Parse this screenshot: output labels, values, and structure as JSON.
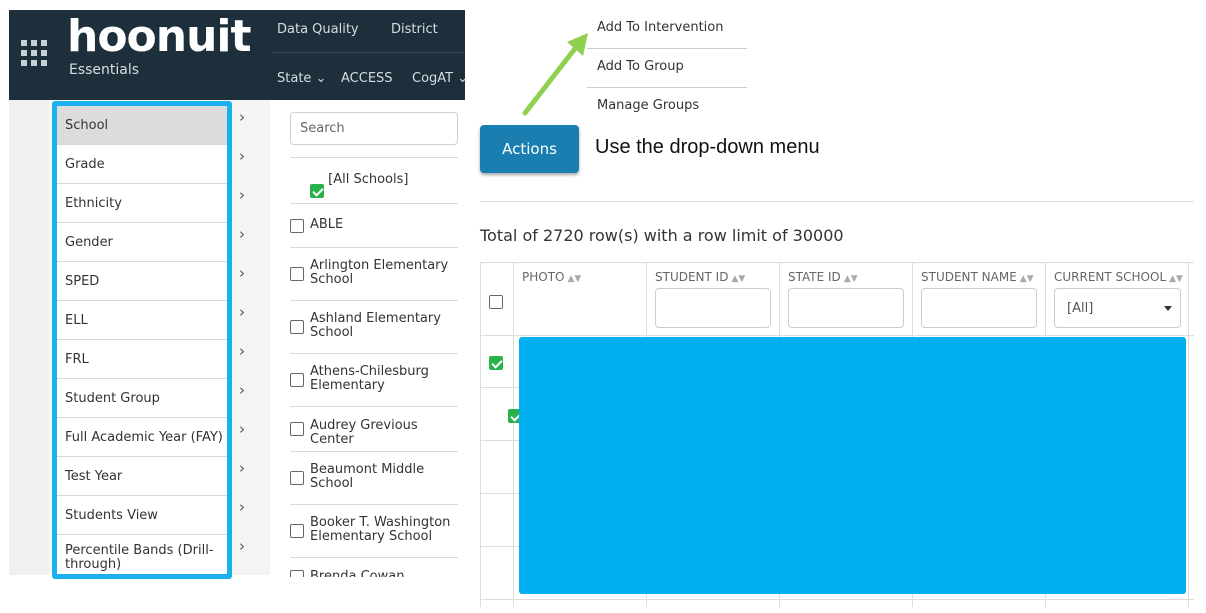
{
  "nav": {
    "logo": "hoonuit",
    "logo_sub": "Essentials",
    "links_top": [
      "Data Quality",
      "District"
    ],
    "links_bottom": [
      "State ⌄",
      "ACCESS",
      "CogAT ⌄"
    ]
  },
  "filters": {
    "items": [
      "School",
      "Grade",
      "Ethnicity",
      "Gender",
      "SPED",
      "ELL",
      "FRL",
      "Student Group",
      "Full Academic Year (FAY)",
      "Test Year",
      "Students View",
      "Percentile Bands (Drill-through)"
    ],
    "selected": "School",
    "highlight_color": "#1bb1ec"
  },
  "schools": {
    "search_placeholder": "Search",
    "items": [
      {
        "label": "[All Schools]",
        "checked": true
      },
      {
        "label": "ABLE",
        "checked": false
      },
      {
        "label": "Arlington Elementary School",
        "checked": false
      },
      {
        "label": "Ashland Elementary School",
        "checked": false
      },
      {
        "label": "Athens-Chilesburg Elementary",
        "checked": false
      },
      {
        "label": "Audrey Grevious Center",
        "checked": false
      },
      {
        "label": "Beaumont Middle School",
        "checked": false
      },
      {
        "label": "Booker T. Washington Elementary School",
        "checked": false
      },
      {
        "label": "Brenda Cowan",
        "checked": false
      }
    ]
  },
  "dropdown": {
    "items": [
      "Add To Intervention",
      "Add To Group",
      "Manage Groups"
    ]
  },
  "actions": {
    "button_label": "Actions",
    "callout": "Use the drop-down menu",
    "arrow_color": "#8fd14f"
  },
  "table": {
    "total_text": "Total of 2720 row(s) with a row limit of 30000",
    "columns": [
      "PHOTO",
      "STUDENT ID",
      "STATE ID",
      "STUDENT NAME",
      "CURRENT SCHOOL"
    ],
    "school_filter_value": "[All]",
    "redaction_color": "#00b0f0"
  }
}
